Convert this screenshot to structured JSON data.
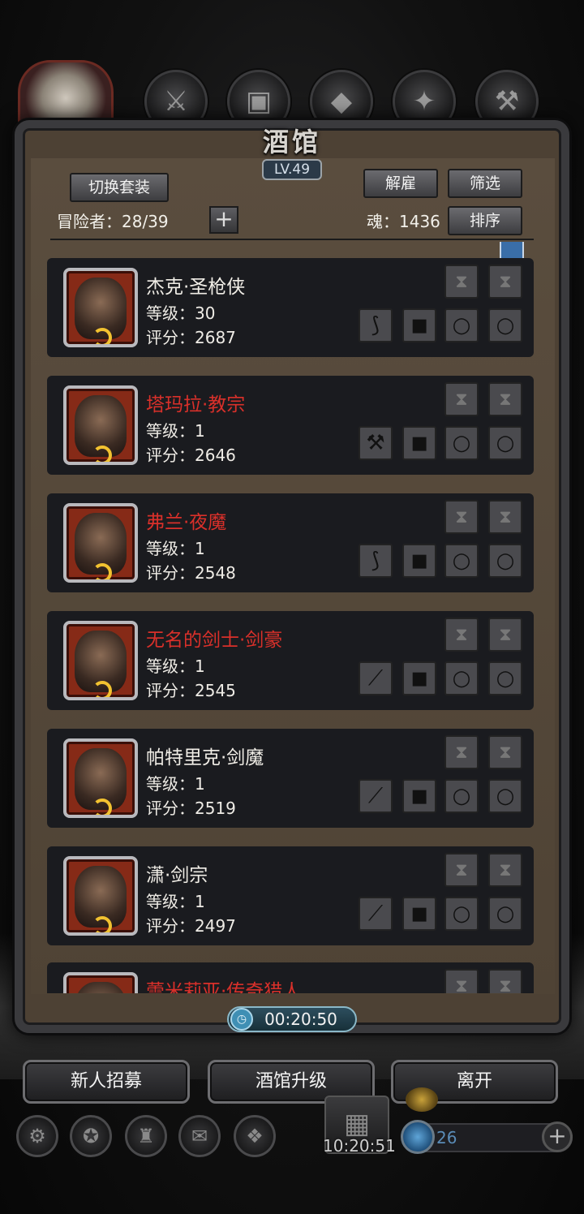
{
  "header": {
    "title": "酒馆",
    "level": "LV.49"
  },
  "top_icons": [
    "horse-badge-icon",
    "weapons-icon",
    "armor-icon",
    "helmet-icon",
    "feathers-icon",
    "crossbow-icon"
  ],
  "toolbar": {
    "switch_outfit": "切换套装",
    "dismiss": "解雇",
    "filter": "筛选",
    "sort": "排序",
    "adventurers_label": "冒险者：28/39",
    "souls_label": "魂：1436"
  },
  "heroes": [
    {
      "name": "杰克·圣枪侠",
      "level": "等级：30",
      "score": "评分：2687",
      "rare": false
    },
    {
      "name": "塔玛拉·教宗",
      "level": "等级：1",
      "score": "评分：2646",
      "rare": true
    },
    {
      "name": "弗兰·夜魔",
      "level": "等级：1",
      "score": "评分：2548",
      "rare": true
    },
    {
      "name": "无名的剑士·剑豪",
      "level": "等级：1",
      "score": "评分：2545",
      "rare": true
    },
    {
      "name": "帕特里克·剑魔",
      "level": "等级：1",
      "score": "评分：2519",
      "rare": false
    },
    {
      "name": "潇·剑宗",
      "level": "等级：1",
      "score": "评分：2497",
      "rare": false
    },
    {
      "name": "蕾米莉亚·传奇猎人",
      "level": "",
      "score": "",
      "rare": true
    }
  ],
  "timer": "00:20:50",
  "actions": {
    "recruit": "新人招募",
    "upgrade": "酒馆升级",
    "leave": "离开"
  },
  "bottom_bar": {
    "clock": "10:20:51",
    "gems": "26"
  },
  "colors": {
    "rare_name": "#d9302a",
    "normal_name": "#f0ede6",
    "card_bg": "#1a1b1f",
    "panel_bg": "#4f4335"
  }
}
